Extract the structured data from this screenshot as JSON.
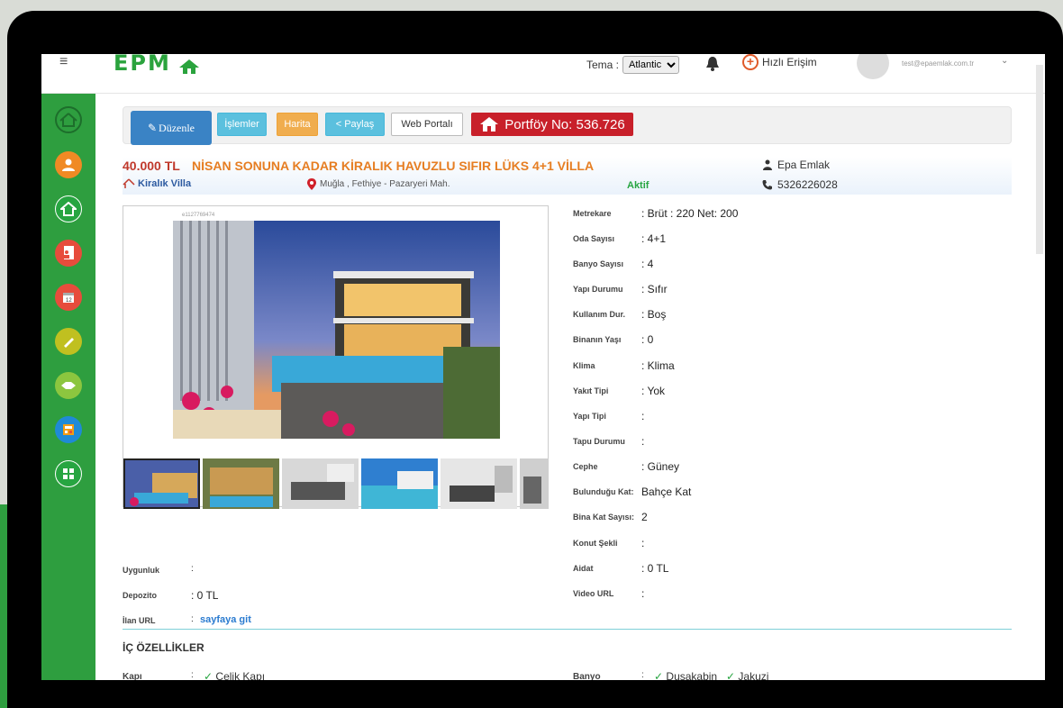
{
  "header": {
    "menu_icon": "≡",
    "logo_text": "EPM",
    "tema_label": "Tema :",
    "tema_selected": "Atlantic",
    "quick_access": "Hızlı Erişim",
    "user_email": "test@epaemlak.com.tr"
  },
  "sidebar": {
    "items": [
      {
        "icon": "home-outline-icon",
        "color": "#2e9e3f"
      },
      {
        "icon": "user-icon",
        "color": "#f08a24"
      },
      {
        "icon": "house-icon",
        "color": "#27a541"
      },
      {
        "icon": "document-person-icon",
        "color": "#e74c3c"
      },
      {
        "icon": "calendar-icon",
        "color": "#e74c3c"
      },
      {
        "icon": "pencil-icon",
        "color": "#c0c020"
      },
      {
        "icon": "handshake-icon",
        "color": "#8cc63f"
      },
      {
        "icon": "report-icon",
        "color": "#1f8ad6"
      },
      {
        "icon": "grid-icon",
        "color": "#27a541"
      }
    ]
  },
  "toolbar": {
    "edit_label": "Düzenle",
    "actions_label": "İşlemler",
    "map_label": "Harita",
    "share_label": "Paylaş",
    "web_portal_label": "Web Portalı",
    "portfolio_label": "Portföy No: 536.726"
  },
  "listing": {
    "price": "40.000 TL",
    "title": "NİSAN SONUNA KADAR KİRALIK HAVUZLU SIFIR LÜKS 4+1 VİLLA",
    "agency": "Epa Emlak",
    "type": "Kiralık Villa",
    "location": "Muğla , Fethiye - Pazaryeri Mah.",
    "status": "Aktif",
    "phone": "5326226028",
    "photo_id": "e1127769474"
  },
  "specs": [
    {
      "label": "Metrekare",
      "value": ": Brüt : 220 Net: 200"
    },
    {
      "label": "Oda Sayısı",
      "value": ": 4+1"
    },
    {
      "label": "Banyo Sayısı",
      "value": ": 4"
    },
    {
      "label": "Yapı Durumu",
      "value": ": Sıfır"
    },
    {
      "label": "Kullanım Dur.",
      "value": ": Boş"
    },
    {
      "label": "Binanın Yaşı",
      "value": ": 0"
    },
    {
      "label": "Klima",
      "value": ": Klima"
    },
    {
      "label": "Yakıt Tipi",
      "value": ": Yok"
    },
    {
      "label": "Yapı Tipi",
      "value": ":"
    },
    {
      "label": "Tapu Durumu",
      "value": ":"
    },
    {
      "label": "Cephe",
      "value": ": Güney"
    },
    {
      "label": "Bulunduğu Kat:",
      "value": "Bahçe Kat"
    },
    {
      "label": "Bina Kat Sayısı:",
      "value": "2"
    },
    {
      "label": "Konut Şekli",
      "value": ":"
    },
    {
      "label": "Aidat",
      "value": ": 0 TL"
    },
    {
      "label": "Video URL",
      "value": ":"
    }
  ],
  "info": {
    "uygunluk_label": "Uygunluk",
    "uygunluk_value": ":",
    "depozito_label": "Depozito",
    "depozito_value": ": 0 TL",
    "ilan_url_label": "İlan URL",
    "ilan_url_colon": ":",
    "ilan_url_link": "sayfaya git"
  },
  "features": {
    "section_title": "İÇ ÖZELLİKLER",
    "rows": [
      {
        "label": "Kapı",
        "colon": ":",
        "values": [
          "Çelik Kapı"
        ]
      },
      {
        "label": "Banyo",
        "colon": ":",
        "values": [
          "Duşakabin",
          "Jakuzi"
        ]
      }
    ]
  }
}
